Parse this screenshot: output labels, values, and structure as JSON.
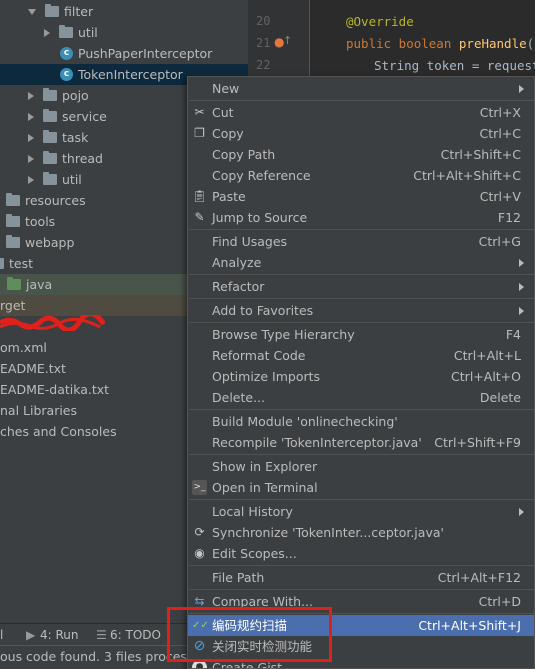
{
  "tree": {
    "items": [
      {
        "label": "filter",
        "kind": "pkg-open"
      },
      {
        "label": "util",
        "kind": "pkg"
      },
      {
        "label": "PushPaperInterceptor",
        "kind": "class"
      },
      {
        "label": "TokenInterceptor",
        "kind": "class"
      },
      {
        "label": "pojo",
        "kind": "pkg"
      },
      {
        "label": "service",
        "kind": "pkg"
      },
      {
        "label": "task",
        "kind": "pkg"
      },
      {
        "label": "thread",
        "kind": "pkg"
      },
      {
        "label": "util",
        "kind": "pkg"
      },
      {
        "label": "resources",
        "kind": "folder"
      },
      {
        "label": "tools",
        "kind": "folder"
      },
      {
        "label": "webapp",
        "kind": "folder"
      },
      {
        "label": "test",
        "kind": "folder"
      },
      {
        "label": "java",
        "kind": "folder-green"
      },
      {
        "label": "rget",
        "kind": "text"
      },
      {
        "label": "om.xml",
        "kind": "text"
      },
      {
        "label": "EADME.txt",
        "kind": "text"
      },
      {
        "label": "EADME-datika.txt",
        "kind": "text"
      },
      {
        "label": "nal Libraries",
        "kind": "text"
      },
      {
        "label": "ches and Consoles",
        "kind": "text"
      }
    ]
  },
  "editor": {
    "lines": [
      {
        "num": "20",
        "code_annotation": "@Override"
      },
      {
        "num": "21",
        "kw": "public boolean ",
        "fn": "preHandle",
        "rest": "(Ht"
      },
      {
        "num": "22",
        "rest": "String token =  request"
      }
    ]
  },
  "menu": {
    "items": [
      {
        "label": "New",
        "shortcut": "",
        "submenu": true,
        "icon": ""
      },
      {
        "label": "Cut",
        "shortcut": "Ctrl+X",
        "icon": "scissors-icon"
      },
      {
        "label": "Copy",
        "shortcut": "Ctrl+C",
        "icon": "copy-icon"
      },
      {
        "label": "Copy Path",
        "shortcut": "Ctrl+Shift+C",
        "icon": ""
      },
      {
        "label": "Copy Reference",
        "shortcut": "Ctrl+Alt+Shift+C",
        "icon": ""
      },
      {
        "label": "Paste",
        "shortcut": "Ctrl+V",
        "icon": "paste-icon"
      },
      {
        "label": "Jump to Source",
        "shortcut": "F12",
        "icon": "pencil-icon"
      },
      {
        "label": "Find Usages",
        "shortcut": "Ctrl+G",
        "icon": ""
      },
      {
        "label": "Analyze",
        "shortcut": "",
        "submenu": true,
        "icon": ""
      },
      {
        "label": "Refactor",
        "shortcut": "",
        "submenu": true,
        "icon": ""
      },
      {
        "label": "Add to Favorites",
        "shortcut": "",
        "submenu": true,
        "icon": ""
      },
      {
        "label": "Browse Type Hierarchy",
        "shortcut": "F4",
        "icon": ""
      },
      {
        "label": "Reformat Code",
        "shortcut": "Ctrl+Alt+L",
        "icon": ""
      },
      {
        "label": "Optimize Imports",
        "shortcut": "Ctrl+Alt+O",
        "icon": ""
      },
      {
        "label": "Delete...",
        "shortcut": "Delete",
        "icon": ""
      },
      {
        "label": "Build Module 'onlinechecking'",
        "shortcut": "",
        "icon": ""
      },
      {
        "label": "Recompile 'TokenInterceptor.java'",
        "shortcut": "Ctrl+Shift+F9",
        "icon": ""
      },
      {
        "label": "Show in Explorer",
        "shortcut": "",
        "icon": ""
      },
      {
        "label": "Open in Terminal",
        "shortcut": "",
        "icon": "terminal-icon"
      },
      {
        "label": "Local History",
        "shortcut": "",
        "submenu": true,
        "icon": ""
      },
      {
        "label": "Synchronize 'TokenInter...ceptor.java'",
        "shortcut": "",
        "icon": "sync-icon"
      },
      {
        "label": "Edit Scopes...",
        "shortcut": "",
        "icon": "scope-icon"
      },
      {
        "label": "File Path",
        "shortcut": "Ctrl+Alt+F12",
        "icon": ""
      },
      {
        "label": "Compare With...",
        "shortcut": "Ctrl+D",
        "icon": "compare-icon"
      },
      {
        "label": "编码规约扫描",
        "shortcut": "Ctrl+Alt+Shift+J",
        "icon": "scan-icon"
      },
      {
        "label": "关闭实时检测功能",
        "shortcut": "",
        "icon": "block-icon"
      },
      {
        "label": "Create Gist...",
        "shortcut": "",
        "icon": "github-icon"
      }
    ]
  },
  "toolbar": {
    "item0": "l",
    "run": "4: Run",
    "todo": "6: TODO"
  },
  "status": {
    "text": "ous code found. 3 files processed"
  },
  "colors": {
    "menu_active": "#4b6eaf",
    "highlight_box": "#e0201b",
    "selected_row": "#0d293e"
  }
}
